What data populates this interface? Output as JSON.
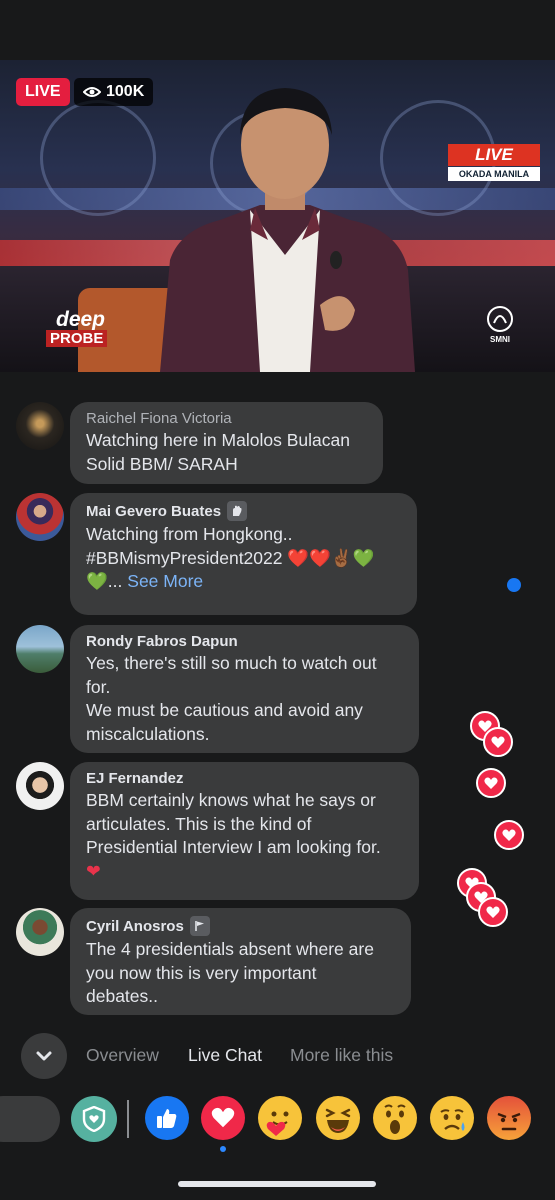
{
  "video": {
    "live_label": "LIVE",
    "viewer_count": "100K",
    "channel_live": "LIVE",
    "channel_location": "OKADA MANILA",
    "show_logo_top": "deep",
    "show_logo_bottom": "PROBE",
    "network_logo": "SMNI"
  },
  "comments": [
    {
      "name": "Raichel Fiona Victoria",
      "text": "Watching here in Malolos Bulacan\nSolid BBM/ SARAH",
      "badge": null
    },
    {
      "name": "Mai Gevero Buates",
      "badge": "clap-hand-icon",
      "text": "Watching from Hongkong..\n#BBMismyPresident2022 ❤️❤️✌🏾💚\n💚...",
      "see_more": "See More"
    },
    {
      "name": "Rondy Fabros Dapun",
      "text": "Yes, there's still so much to watch out\nfor.\nWe must be cautious and avoid any\nmiscalculations."
    },
    {
      "name": "EJ Fernandez",
      "text": "BBM certainly knows what he says or\narticulates. This is the kind of\nPresidential Interview I am looking for.",
      "trail": "❤"
    },
    {
      "name": "Cyril Anosros",
      "badge": "flag-icon",
      "text": "The 4 presidentials absent where are\nyou now this is very important\ndebates.."
    }
  ],
  "tabs": [
    "Overview",
    "Live Chat",
    "More like this"
  ],
  "active_tab": "Live Chat",
  "reactions": [
    "like-icon",
    "love-icon",
    "care-icon",
    "haha-icon",
    "wow-icon",
    "sad-icon",
    "angry-icon"
  ],
  "colors": {
    "live_red": "#e41e3f",
    "like_blue": "#1877f2",
    "love_red": "#f02849",
    "see_more_blue": "#7cb4f7",
    "bubble_bg": "#3a3b3c",
    "page_bg": "#18191a"
  }
}
